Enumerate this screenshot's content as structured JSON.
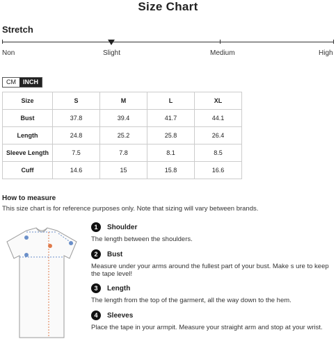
{
  "title": "Size Chart",
  "stretch": {
    "title": "Stretch",
    "levels": [
      "Non",
      "Slight",
      "Medium",
      "High"
    ],
    "selected": "Slight"
  },
  "units": {
    "cm": "CM",
    "inch": "INCH",
    "selected": "INCH"
  },
  "table": {
    "headers": [
      "Size",
      "S",
      "M",
      "L",
      "XL"
    ],
    "rows": [
      {
        "label": "Bust",
        "values": [
          "37.8",
          "39.4",
          "41.7",
          "44.1"
        ]
      },
      {
        "label": "Length",
        "values": [
          "24.8",
          "25.2",
          "25.8",
          "26.4"
        ]
      },
      {
        "label": "Sleeve Length",
        "values": [
          "7.5",
          "7.8",
          "8.1",
          "8.5"
        ]
      },
      {
        "label": "Cuff",
        "values": [
          "14.6",
          "15",
          "15.8",
          "16.6"
        ]
      }
    ]
  },
  "how_to": {
    "title": "How to measure",
    "disclaimer": "This size chart is for reference purposes only. Note that sizing will vary between brands.",
    "steps": [
      {
        "num": "1",
        "title": "Shoulder",
        "desc": "The length between the shoulders."
      },
      {
        "num": "2",
        "title": "Bust",
        "desc": "Measure under your arms around the fullest part of your bust. Make s ure to keep the tape level!"
      },
      {
        "num": "3",
        "title": "Length",
        "desc": "The length from the top of the garment, all the way down to the hem."
      },
      {
        "num": "4",
        "title": "Sleeves",
        "desc": "Place the tape in your armpit. Measure your straight arm and stop at your wrist."
      }
    ]
  },
  "colors": {
    "accent": "#222222",
    "measure_line": "#e07a4a",
    "measure_blue": "#6a8fc9"
  },
  "icons": {
    "shirt": "tshirt-measure-diagram"
  }
}
